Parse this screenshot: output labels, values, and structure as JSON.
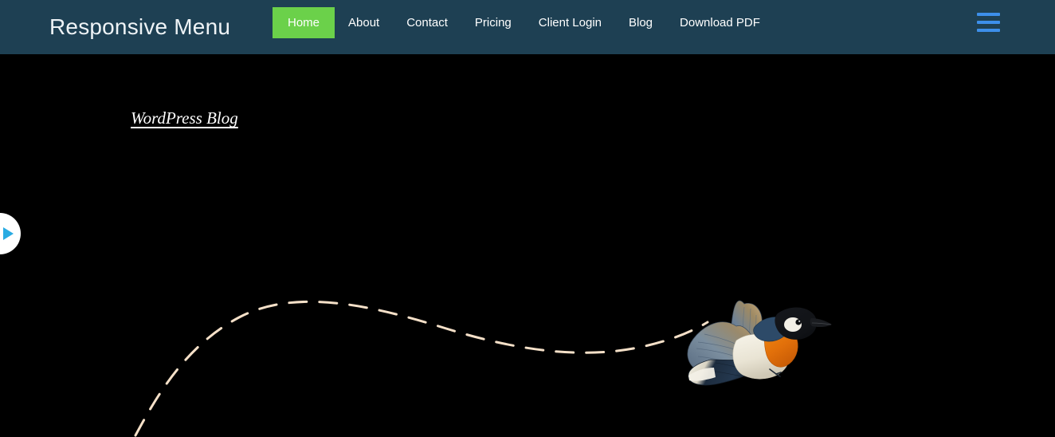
{
  "header": {
    "brand_title": "Responsive Menu",
    "background_color": "#1e4053",
    "active_item_color": "#6bd14a",
    "nav_items": [
      {
        "label": "Home",
        "active": true
      },
      {
        "label": "About",
        "active": false
      },
      {
        "label": "Contact",
        "active": false
      },
      {
        "label": "Pricing",
        "active": false
      },
      {
        "label": "Client Login",
        "active": false
      },
      {
        "label": "Blog",
        "active": false
      },
      {
        "label": "Download PDF",
        "active": false
      }
    ],
    "menu_toggle": {
      "icon": "hamburger-menu-icon",
      "color": "#3d8fea",
      "bars": 3
    }
  },
  "main": {
    "background_color": "#000000",
    "blog_link": {
      "label": "WordPress Blog",
      "color": "#ffffff"
    },
    "media_play_tab": {
      "icon": "play-triangle-icon",
      "circle_color": "#ffffff",
      "triangle_color": "#29abe2"
    },
    "flight_trail": {
      "icon": "dashed-flight-path",
      "color": "#f5e0c8",
      "dash_pattern": "22 16"
    },
    "bird": {
      "icon": "flying-bird-illustration",
      "colors": {
        "cap": "#111317",
        "nape": "#2d4a68",
        "cheek_patch": "#f2efe6",
        "breast": "#e8740c",
        "belly": "#f4f1e6",
        "wing": "#6d8196",
        "wing_edge": "#a88552",
        "tail": "#1b2a3d",
        "tail_tip": "#f2efe6",
        "beak": "#1a1c20"
      }
    }
  }
}
